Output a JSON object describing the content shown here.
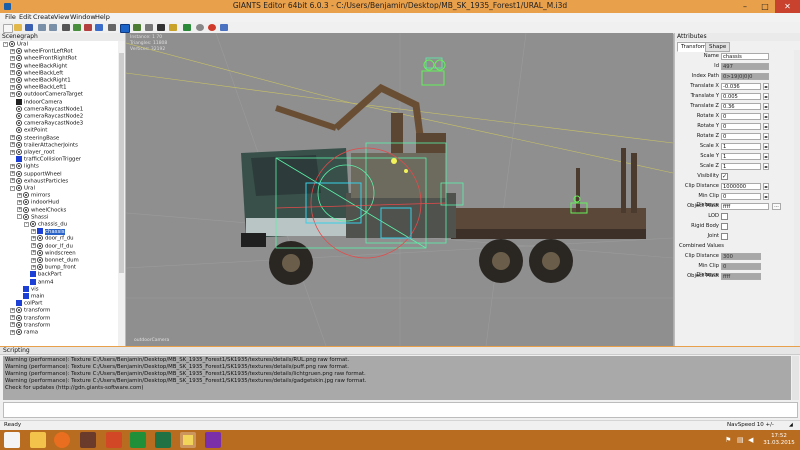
{
  "window": {
    "title": "GIANTS Editor 64bit 6.0.3 - C:/Users/Benjamin/Desktop/MB_SK_1935_Forest1/URAL_M.i3d",
    "min_glyph": "–",
    "max_glyph": "□",
    "close_glyph": "✕"
  },
  "menu": [
    "File",
    "Edit",
    "Create",
    "View",
    "Window",
    "Help"
  ],
  "toolbar": {
    "icons": [
      "new-icon",
      "open-icon",
      "save-icon",
      "undo-icon",
      "redo-icon",
      "select-icon",
      "move-icon",
      "rotate-icon",
      "scale-icon",
      "terrain-icon",
      "paint-icon",
      "foliage-icon",
      "grid-icon",
      "camera-icon",
      "light-icon",
      "play-icon",
      "settings-icon",
      "record-icon",
      "info-icon"
    ]
  },
  "scenegraph": {
    "title": "Scenegraph",
    "rows": [
      {
        "label": "Ural",
        "depth": 0,
        "expander": "-",
        "icon": "tg"
      },
      {
        "label": "wheelFrontLeftRot",
        "depth": 1,
        "expander": "+",
        "icon": "tg"
      },
      {
        "label": "wheelFrontRightRot",
        "depth": 1,
        "expander": "+",
        "icon": "tg"
      },
      {
        "label": "wheelBackRight",
        "depth": 1,
        "expander": "+",
        "icon": "tg"
      },
      {
        "label": "wheelBackLeft",
        "depth": 1,
        "expander": "+",
        "icon": "tg"
      },
      {
        "label": "wheelBackRight1",
        "depth": 1,
        "expander": "+",
        "icon": "tg"
      },
      {
        "label": "wheelBackLeft1",
        "depth": 1,
        "expander": "+",
        "icon": "tg"
      },
      {
        "label": "outdoorCameraTarget",
        "depth": 1,
        "expander": "+",
        "icon": "tg"
      },
      {
        "label": "indoorCamera",
        "depth": 1,
        "expander": "",
        "icon": "cam"
      },
      {
        "label": "cameraRaycastNode1",
        "depth": 1,
        "expander": "",
        "icon": "tg"
      },
      {
        "label": "cameraRaycastNode2",
        "depth": 1,
        "expander": "",
        "icon": "tg"
      },
      {
        "label": "cameraRaycastNode3",
        "depth": 1,
        "expander": "",
        "icon": "tg"
      },
      {
        "label": "exitPoint",
        "depth": 1,
        "expander": "",
        "icon": "tg"
      },
      {
        "label": "steeringBase",
        "depth": 1,
        "expander": "+",
        "icon": "tg"
      },
      {
        "label": "trailerAttacherJoints",
        "depth": 1,
        "expander": "+",
        "icon": "tg"
      },
      {
        "label": "player_root",
        "depth": 1,
        "expander": "+",
        "icon": "tg"
      },
      {
        "label": "trafficCollisionTrigger",
        "depth": 1,
        "expander": "",
        "icon": "sh"
      },
      {
        "label": "lights",
        "depth": 1,
        "expander": "+",
        "icon": "tg"
      },
      {
        "label": "supportWheel",
        "depth": 1,
        "expander": "+",
        "icon": "tg"
      },
      {
        "label": "exhaustParticles",
        "depth": 1,
        "expander": "+",
        "icon": "tg"
      },
      {
        "label": "Ural",
        "depth": 1,
        "expander": "-",
        "icon": "tg"
      },
      {
        "label": "mirrors",
        "depth": 2,
        "expander": "+",
        "icon": "tg"
      },
      {
        "label": "indoorHud",
        "depth": 2,
        "expander": "+",
        "icon": "tg"
      },
      {
        "label": "wheelChocks",
        "depth": 2,
        "expander": "+",
        "icon": "tg"
      },
      {
        "label": "Shassi",
        "depth": 2,
        "expander": "-",
        "icon": "tg"
      },
      {
        "label": "chassis_du",
        "depth": 3,
        "expander": "-",
        "icon": "tg"
      },
      {
        "label": "chassis",
        "depth": 4,
        "expander": "+",
        "icon": "sh",
        "selected": true
      },
      {
        "label": "door_rf_du",
        "depth": 4,
        "expander": "+",
        "icon": "tg"
      },
      {
        "label": "door_lf_du",
        "depth": 4,
        "expander": "+",
        "icon": "tg"
      },
      {
        "label": "windscreen",
        "depth": 4,
        "expander": "+",
        "icon": "tg"
      },
      {
        "label": "bonnet_dum",
        "depth": 4,
        "expander": "+",
        "icon": "tg"
      },
      {
        "label": "bump_front",
        "depth": 4,
        "expander": "+",
        "icon": "tg"
      },
      {
        "label": "backPart",
        "depth": 3,
        "expander": "",
        "icon": "sh"
      },
      {
        "label": "anm4",
        "depth": 3,
        "expander": "",
        "icon": "sh"
      },
      {
        "label": "vis",
        "depth": 2,
        "expander": "",
        "icon": "sh"
      },
      {
        "label": "main",
        "depth": 2,
        "expander": "",
        "icon": "sh"
      },
      {
        "label": "colPart",
        "depth": 1,
        "expander": "",
        "icon": "sh"
      },
      {
        "label": "transform",
        "depth": 1,
        "expander": "+",
        "icon": "tg"
      },
      {
        "label": "transform",
        "depth": 1,
        "expander": "+",
        "icon": "tg"
      },
      {
        "label": "transform",
        "depth": 1,
        "expander": "+",
        "icon": "tg"
      },
      {
        "label": "rama",
        "depth": 1,
        "expander": "+",
        "icon": "tg"
      }
    ]
  },
  "viewport": {
    "info": [
      "Instance: 1 70",
      "Triangles: 11808",
      "Vertices: 32192"
    ],
    "camera_label": "outdoorCamera"
  },
  "attributes": {
    "title": "Attributes",
    "tabs": [
      "Transform",
      "Shape"
    ],
    "name_label": "Name",
    "name_value": "chassis",
    "id_label": "Id",
    "id_value": "497",
    "indexpath_label": "Index Path",
    "indexpath_value": "0>19|0|0|0",
    "fields": [
      {
        "label": "Translate X",
        "value": "-0.036"
      },
      {
        "label": "Translate Y",
        "value": "0.005"
      },
      {
        "label": "Translate Z",
        "value": "0.36"
      },
      {
        "label": "Rotate X",
        "value": "0"
      },
      {
        "label": "Rotate Y",
        "value": "0"
      },
      {
        "label": "Rotate Z",
        "value": "0"
      },
      {
        "label": "Scale X",
        "value": "1"
      },
      {
        "label": "Scale Y",
        "value": "1"
      },
      {
        "label": "Scale Z",
        "value": "1"
      }
    ],
    "visibility_label": "Visibility",
    "visibility_check": "✓",
    "clip_label": "Clip Distance",
    "clip_value": "1000000",
    "minclip_label": "Min Clip Distance",
    "minclip_value": "0",
    "objmask_label": "Object Mask",
    "objmask_value": "ffff",
    "dots_label": "...",
    "lod_label": "LOD",
    "rigid_label": "Rigid Body",
    "joint_label": "Joint",
    "combined_label": "Combined Values",
    "combined": [
      {
        "label": "Clip Distance",
        "value": "300"
      },
      {
        "label": "Min Clip Distance",
        "value": "0"
      },
      {
        "label": "Object Mask",
        "value": "ffff"
      }
    ]
  },
  "scripting": {
    "title": "Scripting",
    "lines": [
      "Warning (performance): Texture C:/Users/Benjamin/Desktop/MB_SK_1935_Forest1/SK1935/textures/details/RUL.png raw format.",
      "Warning (performance): Texture C:/Users/Benjamin/Desktop/MB_SK_1935_Forest1/SK1935/textures/details/puff.png raw format.",
      "Warning (performance): Texture C:/Users/Benjamin/Desktop/MB_SK_1935_Forest1/SK1935/textures/details/lichtgruen.png raw format.",
      "Warning (performance): Texture C:/Users/Benjamin/Desktop/MB_SK_1935_Forest1/SK1935/textures/details/gadgetskin.jpg raw format.",
      "Check for updates (http://gdn.giants-software.com)"
    ]
  },
  "status": {
    "left": "Ready",
    "navspeed": "NavSpeed 10 +/-"
  },
  "taskbar": {
    "apps": [
      "windows-start-icon",
      "file-explorer-icon",
      "firefox-icon",
      "media-icon",
      "powerpoint-icon",
      "store-icon",
      "excel-icon",
      "giants-editor-icon",
      "search-app-icon"
    ],
    "time": "17:52",
    "date": "31.03.2015"
  },
  "colors": {
    "titlebar": "#e9a04b",
    "taskbar": "#b86c1f",
    "viewport_bg": "#8f8f8f",
    "selection": "#2a64c8",
    "log_bg": "#a9a9a9"
  }
}
